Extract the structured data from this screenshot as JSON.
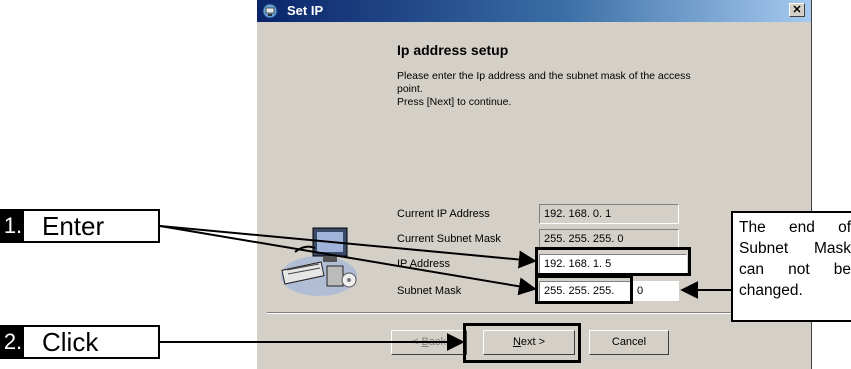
{
  "window": {
    "title": "Set IP",
    "close_label": "✕",
    "heading": "Ip address setup",
    "instructions": [
      "Please enter the Ip address and the subnet mask of the access",
      "point.",
      "Press [Next] to continue."
    ]
  },
  "fields": {
    "current_ip": {
      "label": "Current IP Address",
      "value": "192. 168. 0. 1"
    },
    "current_mask": {
      "label": "Current Subnet Mask",
      "value": "255. 255. 255.  0"
    },
    "ip": {
      "label": "IP Address",
      "value": "192. 168. 1. 5"
    },
    "mask": {
      "label": "Subnet Mask",
      "value": "255. 255. 255.",
      "last_octet": "0"
    }
  },
  "buttons": {
    "back": {
      "prefix": "< ",
      "mnemonic": "B",
      "suffix": "ack"
    },
    "next": {
      "mnemonic": "N",
      "suffix": "ext >"
    },
    "cancel": "Cancel"
  },
  "annotations": {
    "step1": {
      "number": "1.",
      "word": "Enter"
    },
    "step2": {
      "number": "2.",
      "word": "Click"
    },
    "note_lines": [
      "The end of",
      "Subnet Mask",
      "can not be",
      "changed."
    ]
  },
  "colors": {
    "dialog_face": "#d4d0c8",
    "title_bar_start": "#0a246a",
    "title_bar_end": "#a6caf0",
    "annotation": "#000000"
  }
}
